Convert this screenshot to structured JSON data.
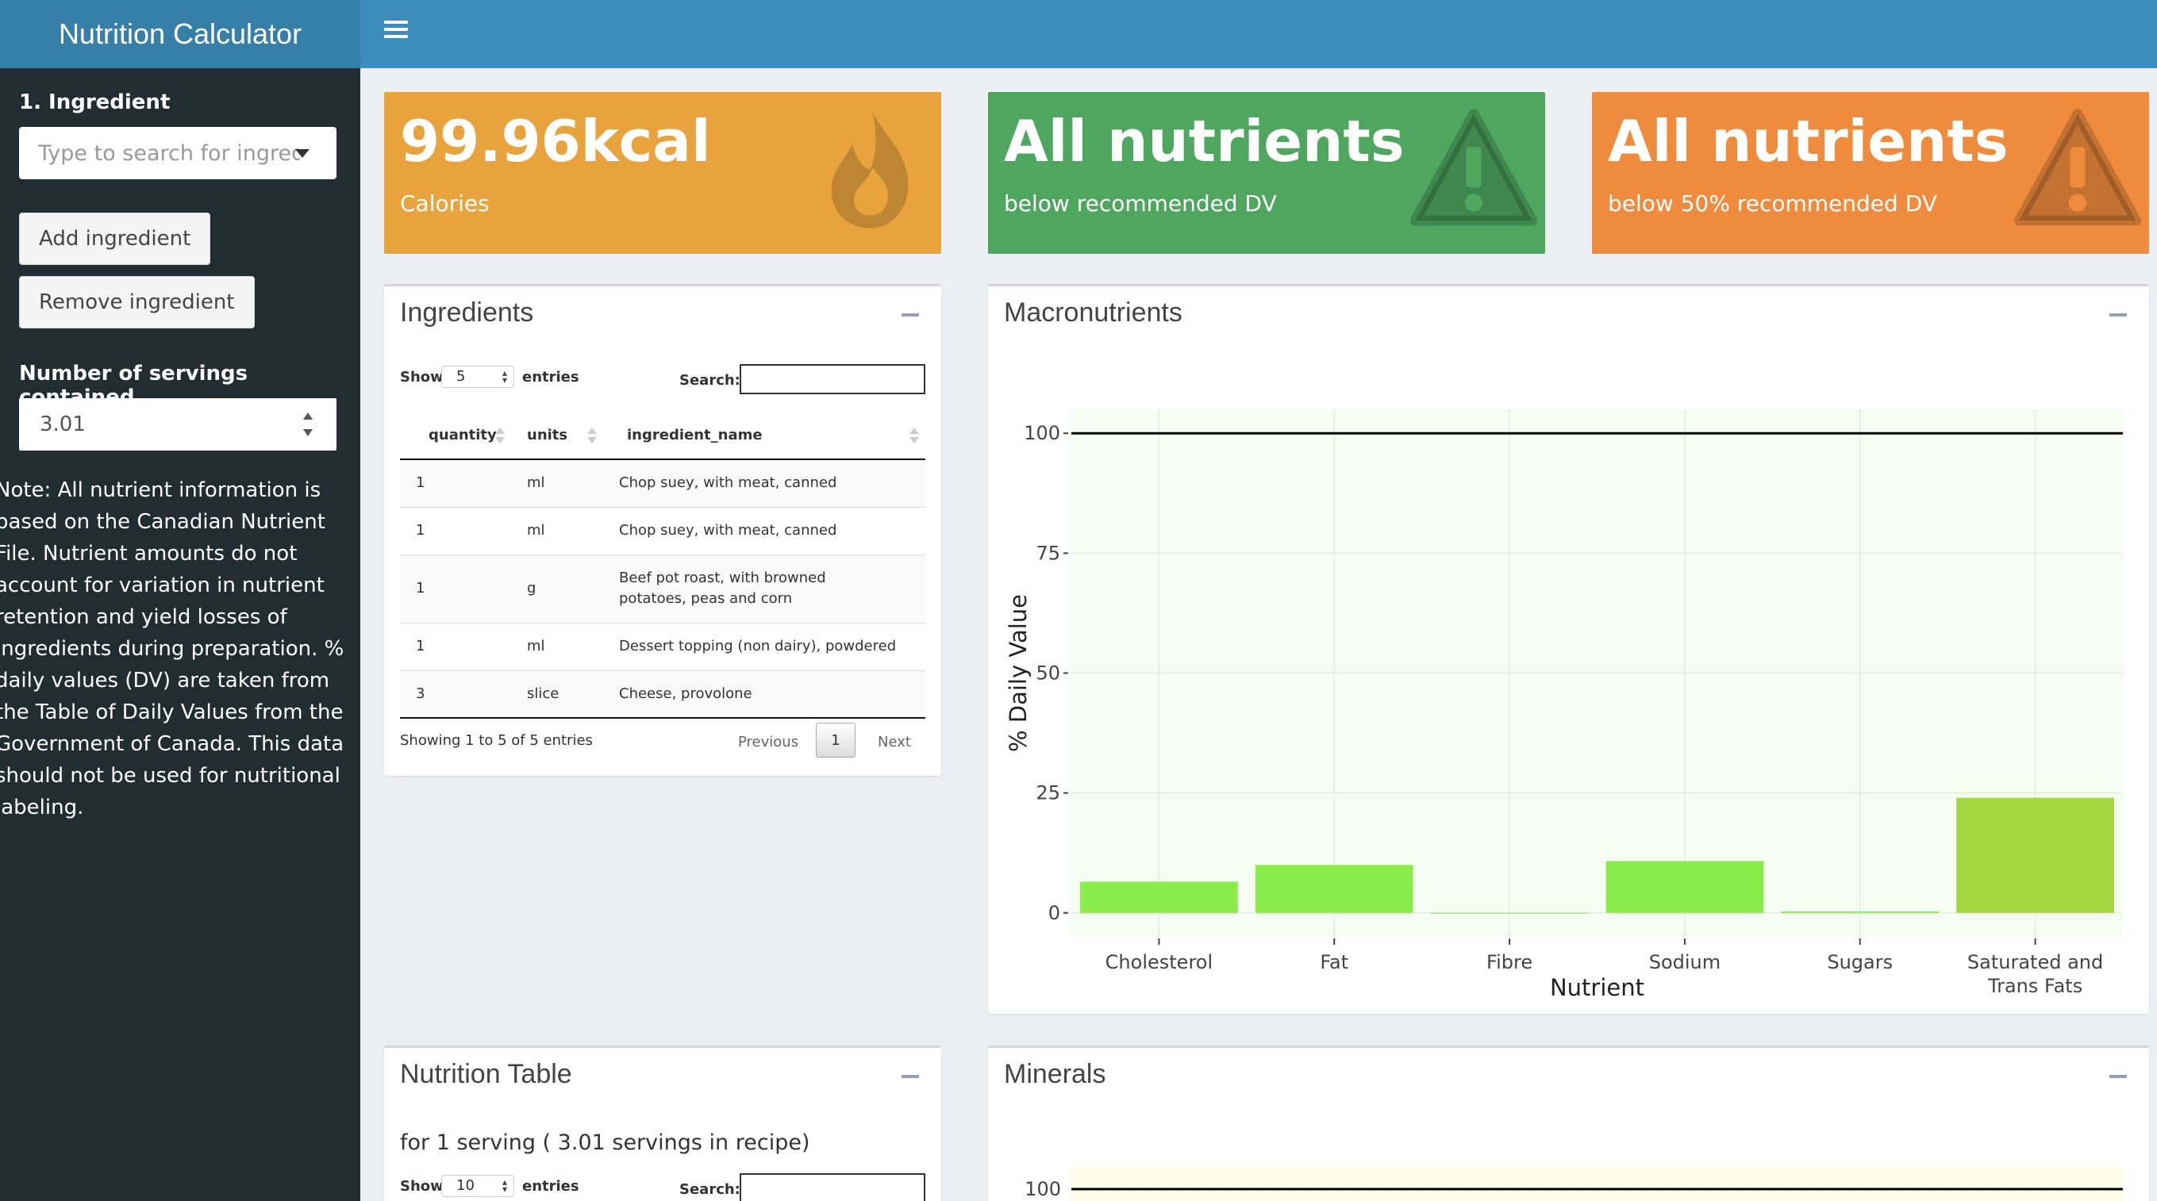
{
  "app": {
    "title": "Nutrition Calculator"
  },
  "sidebar": {
    "ingredient_label": "1. Ingredient",
    "ingredient_placeholder": "Type to search for ingredient",
    "add_button": "Add ingredient",
    "remove_button": "Remove ingredient",
    "servings_label": "Number of servings contained",
    "servings_value": "3.01",
    "note": "Note: All nutrient information is based on the Canadian Nutrient File. Nutrient amounts do not account for variation in nutrient retention and yield losses of ingredients during preparation. % daily values (DV) are taken from the Table of Daily Values from the Government of Canada. This data should not be used for nutritional labeling."
  },
  "value_boxes": [
    {
      "value": "99.96kcal",
      "subtitle": "Calories",
      "icon": "fire-icon",
      "color": "#e8a33d"
    },
    {
      "value": "All nutrients",
      "subtitle": "below recommended DV",
      "icon": "warning-icon",
      "color": "#4ea65f"
    },
    {
      "value": "All nutrients",
      "subtitle": "below 50% recommended DV",
      "icon": "warning-icon",
      "color": "#ef8b3c"
    }
  ],
  "ingredients_box": {
    "title": "Ingredients",
    "show_label": "Show",
    "entries_label": "entries",
    "length_value": "5",
    "search_label": "Search:",
    "columns": [
      "quantity",
      "units",
      "ingredient_name"
    ],
    "rows": [
      {
        "quantity": "1",
        "units": "ml",
        "name": "Chop suey, with meat, canned"
      },
      {
        "quantity": "1",
        "units": "ml",
        "name": "Chop suey, with meat, canned"
      },
      {
        "quantity": "1",
        "units": "g",
        "name": "Beef pot roast, with browned potatoes, peas and corn"
      },
      {
        "quantity": "1",
        "units": "ml",
        "name": "Dessert topping (non dairy), powdered"
      },
      {
        "quantity": "3",
        "units": "slice",
        "name": "Cheese, provolone"
      }
    ],
    "info": "Showing 1 to 5 of 5 entries",
    "previous": "Previous",
    "page": "1",
    "next": "Next"
  },
  "macronutrients_box": {
    "title": "Macronutrients"
  },
  "nutrition_table_box": {
    "title": "Nutrition Table",
    "caption": "for 1 serving ( 3.01 servings in recipe)",
    "show_label": "Show",
    "length_value": "10",
    "entries_label": "entries",
    "search_label": "Search:"
  },
  "minerals_box": {
    "title": "Minerals",
    "tick_100": "100"
  },
  "chart_data": [
    {
      "type": "bar",
      "categories": [
        "Cholesterol",
        "Fat",
        "Fibre",
        "Sodium",
        "Sugars",
        "Saturated and Trans Fats"
      ],
      "values": [
        6.5,
        10,
        0,
        10.8,
        0.3,
        24
      ],
      "bar_colors": [
        "#89ec4a",
        "#89ec4a",
        "#89ec4a",
        "#89ec4a",
        "#89ec4a",
        "#a5d843"
      ],
      "reference_line": 100,
      "xlabel": "Nutrient",
      "ylabel": "% Daily Value",
      "yticks": [
        0,
        25,
        50,
        75,
        100
      ],
      "ylim": [
        -5,
        105
      ],
      "grid": true
    }
  ]
}
